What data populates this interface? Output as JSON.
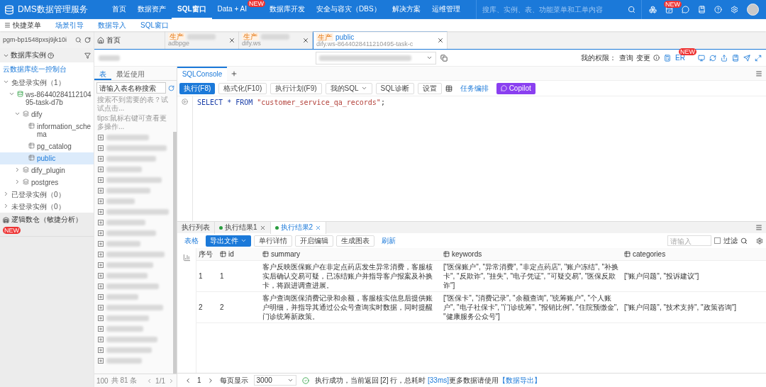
{
  "nav": {
    "logo": "DMS数据管理服务",
    "items": [
      {
        "label": "首页",
        "selected": false
      },
      {
        "label": "数据资产",
        "selected": false
      },
      {
        "label": "SQL窗口",
        "selected": true
      },
      {
        "label": "Data + AI",
        "selected": false,
        "badge": "NEW"
      },
      {
        "label": "数据库开发",
        "selected": false
      },
      {
        "label": "安全与容灾（DBS）",
        "selected": false
      },
      {
        "label": "解决方案",
        "selected": false
      },
      {
        "label": "运维管理",
        "selected": false
      }
    ],
    "search": {
      "placeholder": "搜库、实例、表、功能菜单和工单内容"
    },
    "icon_badge": "NEW"
  },
  "subnav": {
    "menu": "快捷菜单",
    "links": [
      "场景引导",
      "数据导入",
      "SQL窗口"
    ]
  },
  "sidebar": {
    "instance_search": {
      "value": "pgm-bp1548pxsj9jk10i"
    },
    "heading": "数据库实例",
    "console_link": "云数据库统一控制台",
    "tree": [
      {
        "label": "免登录实例（1）",
        "expanded": true,
        "children": [
          {
            "label": "ws-8644028411210495-task-d7b",
            "expanded": true,
            "kind": "instance",
            "children": [
              {
                "label": "dify",
                "expanded": true,
                "kind": "database",
                "children": [
                  {
                    "label": "information_schema",
                    "selected": false,
                    "kind": "schema"
                  },
                  {
                    "label": "pg_catalog",
                    "selected": false,
                    "kind": "schema"
                  },
                  {
                    "label": "public",
                    "selected": true,
                    "kind": "schema"
                  }
                ]
              },
              {
                "label": "dify_plugin",
                "expanded": false,
                "kind": "database"
              },
              {
                "label": "postgres",
                "expanded": false,
                "kind": "database"
              }
            ]
          }
        ]
      },
      {
        "label": "已登录实例（0）",
        "expanded": false
      },
      {
        "label": "未登录实例（0）",
        "expanded": false
      }
    ],
    "footer": {
      "label": "逻辑数仓（敏捷分析）",
      "badge": "NEW"
    }
  },
  "doc_tabs": [
    {
      "kind": "home",
      "label": "首页",
      "selected": false
    },
    {
      "kind": "db",
      "env": "生产",
      "sub": "adbpge",
      "redacted": true,
      "selected": false
    },
    {
      "kind": "db",
      "env": "生产",
      "sub": "dify.ws",
      "redacted": true,
      "selected": false
    },
    {
      "kind": "db",
      "env": "生产",
      "label": "public",
      "sub": "dify.ws-8644028411210495-task-c",
      "selected": true
    }
  ],
  "toolbar": {
    "permission_label": "我的权限：",
    "permissions": [
      "查询",
      "变更"
    ],
    "er": "ER",
    "badge": "NEW"
  },
  "table_panel": {
    "tabs": [
      {
        "label": "表",
        "selected": true
      },
      {
        "label": "最近使用",
        "selected": false
      }
    ],
    "search": {
      "placeholder": "请输入表名称搜索"
    },
    "tips": [
      "搜索不到需要的表？试试点击...",
      "tips:鼠标右键可查看更多操作..."
    ],
    "tables": [
      {
        "kind": "redacted"
      },
      {
        "kind": "redacted"
      },
      {
        "kind": "redacted"
      },
      {
        "kind": "redacted"
      },
      {
        "kind": "redacted"
      },
      {
        "kind": "redacted"
      },
      {
        "kind": "redacted"
      },
      {
        "kind": "redacted"
      },
      {
        "kind": "redacted"
      },
      {
        "kind": "redacted"
      },
      {
        "kind": "redacted"
      },
      {
        "kind": "redacted"
      },
      {
        "kind": "redacted"
      },
      {
        "kind": "redacted"
      },
      {
        "kind": "redacted"
      },
      {
        "kind": "redacted"
      },
      {
        "kind": "redacted"
      },
      {
        "kind": "redacted"
      },
      {
        "kind": "redacted"
      },
      {
        "kind": "redacted"
      },
      {
        "kind": "redacted"
      },
      {
        "kind": "redacted"
      }
    ],
    "pager": {
      "page_size": "100",
      "total": "共 81 条",
      "page": "1/1"
    }
  },
  "editor": {
    "tabs": [
      {
        "label": "SQLConsole",
        "selected": true
      }
    ],
    "buttons": [
      {
        "label": "执行(F8)",
        "kind": "primary"
      },
      {
        "label": "格式化(F10)",
        "kind": "plain"
      },
      {
        "label": "执行计划(F9)",
        "kind": "plain"
      },
      {
        "label": "我的SQL",
        "kind": "dropdown"
      },
      {
        "label": "SQL诊断",
        "kind": "plain"
      },
      {
        "label": "设置",
        "kind": "plain"
      },
      {
        "label": "任务编排",
        "kind": "link"
      },
      {
        "label": "Copilot",
        "kind": "copilot"
      }
    ],
    "code": [
      {
        "keyword": "SELECT * FROM ",
        "string": "\"customer_service_qa_records\"",
        "end": ";"
      }
    ]
  },
  "results": {
    "tabs": [
      {
        "label": "执行列表",
        "selected": false,
        "kind": "list"
      },
      {
        "label": "执行结果1",
        "selected": false,
        "kind": "result"
      },
      {
        "label": "执行结果2",
        "selected": true,
        "kind": "result"
      }
    ],
    "actions": [
      {
        "label": "表格",
        "kind": "link"
      },
      {
        "label": "导出文件",
        "kind": "primary"
      },
      {
        "label": "单行详情",
        "kind": "plain"
      },
      {
        "label": "开启编辑",
        "kind": "plain"
      },
      {
        "label": "生成图表",
        "kind": "plain"
      },
      {
        "label": "刷新",
        "kind": "link"
      }
    ],
    "filter": {
      "placeholder": "请输入",
      "button": "过滤",
      "checked": false
    },
    "table": {
      "columns": [
        "序号",
        "id",
        "summary",
        "keywords",
        "categories"
      ],
      "rows": [
        [
          "1",
          "1",
          "客户反映医保账户在非定点药店发生异常消费，客服核实后确认交易可疑，已冻结账户并指导客户报案及补换卡，将跟进调查进展。",
          "[\"医保账户\", \"异常消费\", \"非定点药店\", \"账户冻结\", \"补换卡\", \"反欺诈\", \"挂失\", \"电子凭证\", \"可疑交易\", \"医保反欺诈\"]",
          "[\"账户问题\", \"投诉建议\"]"
        ],
        [
          "2",
          "2",
          "客户查询医保消费记录和余额，客服核实信息后提供账户明细，并指导其通过公众号查询实时数据，同时提醒门诊统筹新政策。",
          "[\"医保卡\", \"消费记录\", \"余额查询\", \"统筹账户\", \"个人账户\", \"电子社保卡\", \"门诊统筹\", \"报销比例\", \"住院预缴金\", \"健康服务公众号\"]",
          "[\"账户问题\", \"技术支持\", \"政策咨询\"]"
        ]
      ]
    },
    "footer": {
      "page": "1",
      "page_size_label": "每页显示",
      "page_size": "3000",
      "status": [
        "执行成功，当前返回 [2] 行，总耗时 ",
        "[33ms]",
        "更多数据请使用"
      ],
      "export_link": "【数据导出】"
    }
  }
}
